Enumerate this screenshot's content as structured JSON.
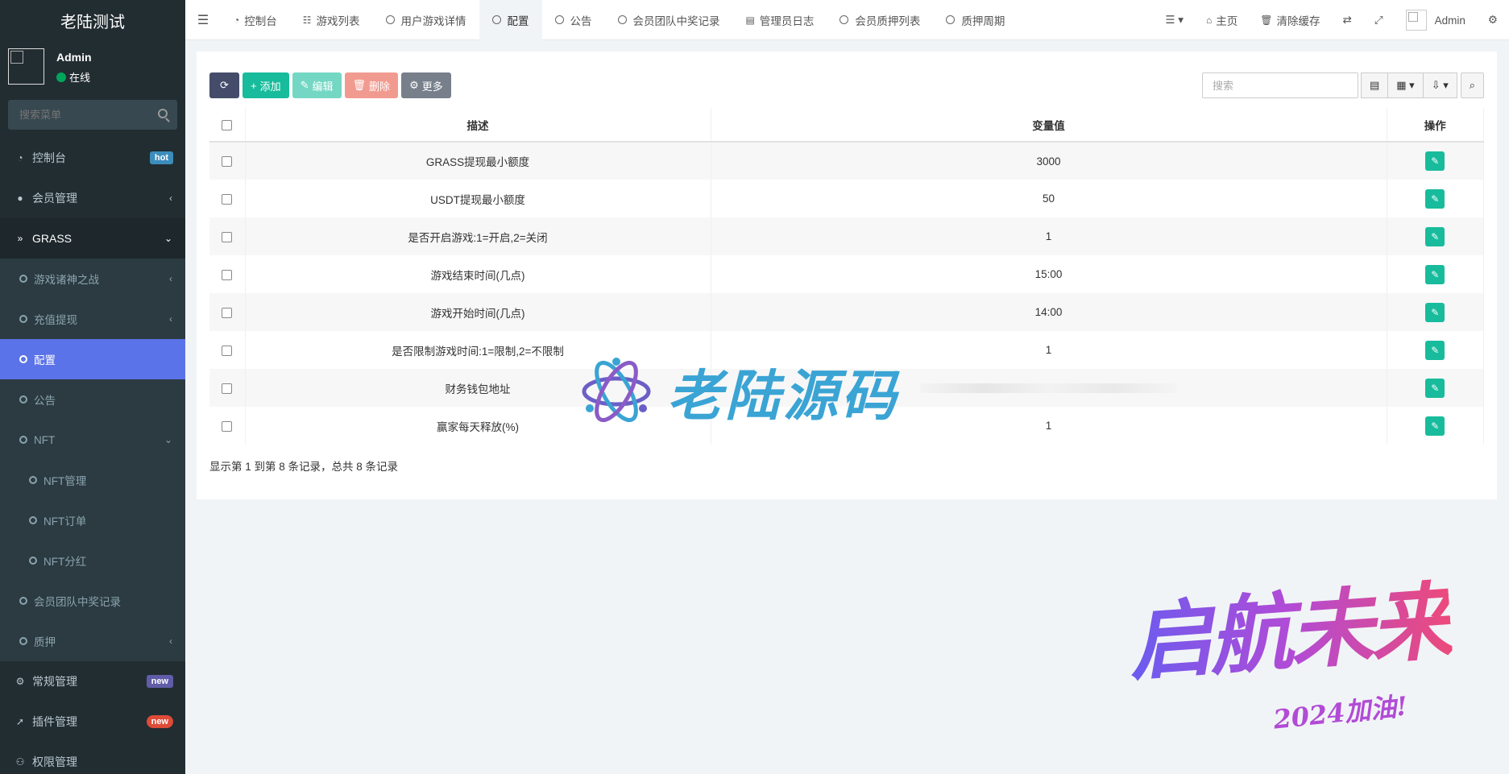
{
  "app": {
    "title": "老陆测试"
  },
  "user": {
    "name": "Admin",
    "status": "在线"
  },
  "sidebar": {
    "search_placeholder": "搜索菜单",
    "items": [
      {
        "label": "控制台",
        "icon": "dashboard-icon",
        "badge": "hot"
      },
      {
        "label": "会员管理",
        "icon": "user-circle-icon"
      },
      {
        "label": "GRASS",
        "icon": "double-chevron-icon"
      },
      {
        "label": "游戏诸神之战"
      },
      {
        "label": "充值提现"
      },
      {
        "label": "配置"
      },
      {
        "label": "公告"
      },
      {
        "label": "NFT"
      },
      {
        "label": "NFT管理"
      },
      {
        "label": "NFT订单"
      },
      {
        "label": "NFT分红"
      },
      {
        "label": "会员团队中奖记录"
      },
      {
        "label": "质押"
      },
      {
        "label": "常规管理",
        "icon": "cogs-icon",
        "badge": "new"
      },
      {
        "label": "插件管理",
        "icon": "rocket-icon",
        "badge": "new"
      },
      {
        "label": "权限管理"
      }
    ]
  },
  "navbar": {
    "tabs": [
      {
        "label": "控制台"
      },
      {
        "label": "游戏列表"
      },
      {
        "label": "用户游戏详情"
      },
      {
        "label": "配置"
      },
      {
        "label": "公告"
      },
      {
        "label": "会员团队中奖记录"
      },
      {
        "label": "管理员日志"
      },
      {
        "label": "会员质押列表"
      },
      {
        "label": "质押周期"
      }
    ],
    "home": "主页",
    "clear_cache": "清除缓存",
    "admin": "Admin"
  },
  "toolbar": {
    "add": "添加",
    "edit": "编辑",
    "delete": "删除",
    "more": "更多",
    "search_placeholder": "搜索"
  },
  "table": {
    "headers": [
      "描述",
      "变量值",
      "操作"
    ],
    "rows": [
      {
        "desc": "GRASS提现最小额度",
        "value": "3000"
      },
      {
        "desc": "USDT提现最小额度",
        "value": "50"
      },
      {
        "desc": "是否开启游戏:1=开启,2=关闭",
        "value": "1"
      },
      {
        "desc": "游戏结束时间(几点)",
        "value": "15:00"
      },
      {
        "desc": "游戏开始时间(几点)",
        "value": "14:00"
      },
      {
        "desc": "是否限制游戏时间:1=限制,2=不限制",
        "value": "1"
      },
      {
        "desc": "财务钱包地址",
        "value": ""
      },
      {
        "desc": "赢家每天释放(%)",
        "value": "1"
      }
    ]
  },
  "pagination": {
    "info": "显示第 1 到第 8 条记录，总共 8 条记录"
  },
  "watermarks": {
    "center": "老陆源码",
    "corner": "启航未来",
    "corner_sub": "2024加油!"
  },
  "colors": {
    "sidebar": "#222d32",
    "accent": "#5b73e8",
    "success": "#18bc9c"
  }
}
